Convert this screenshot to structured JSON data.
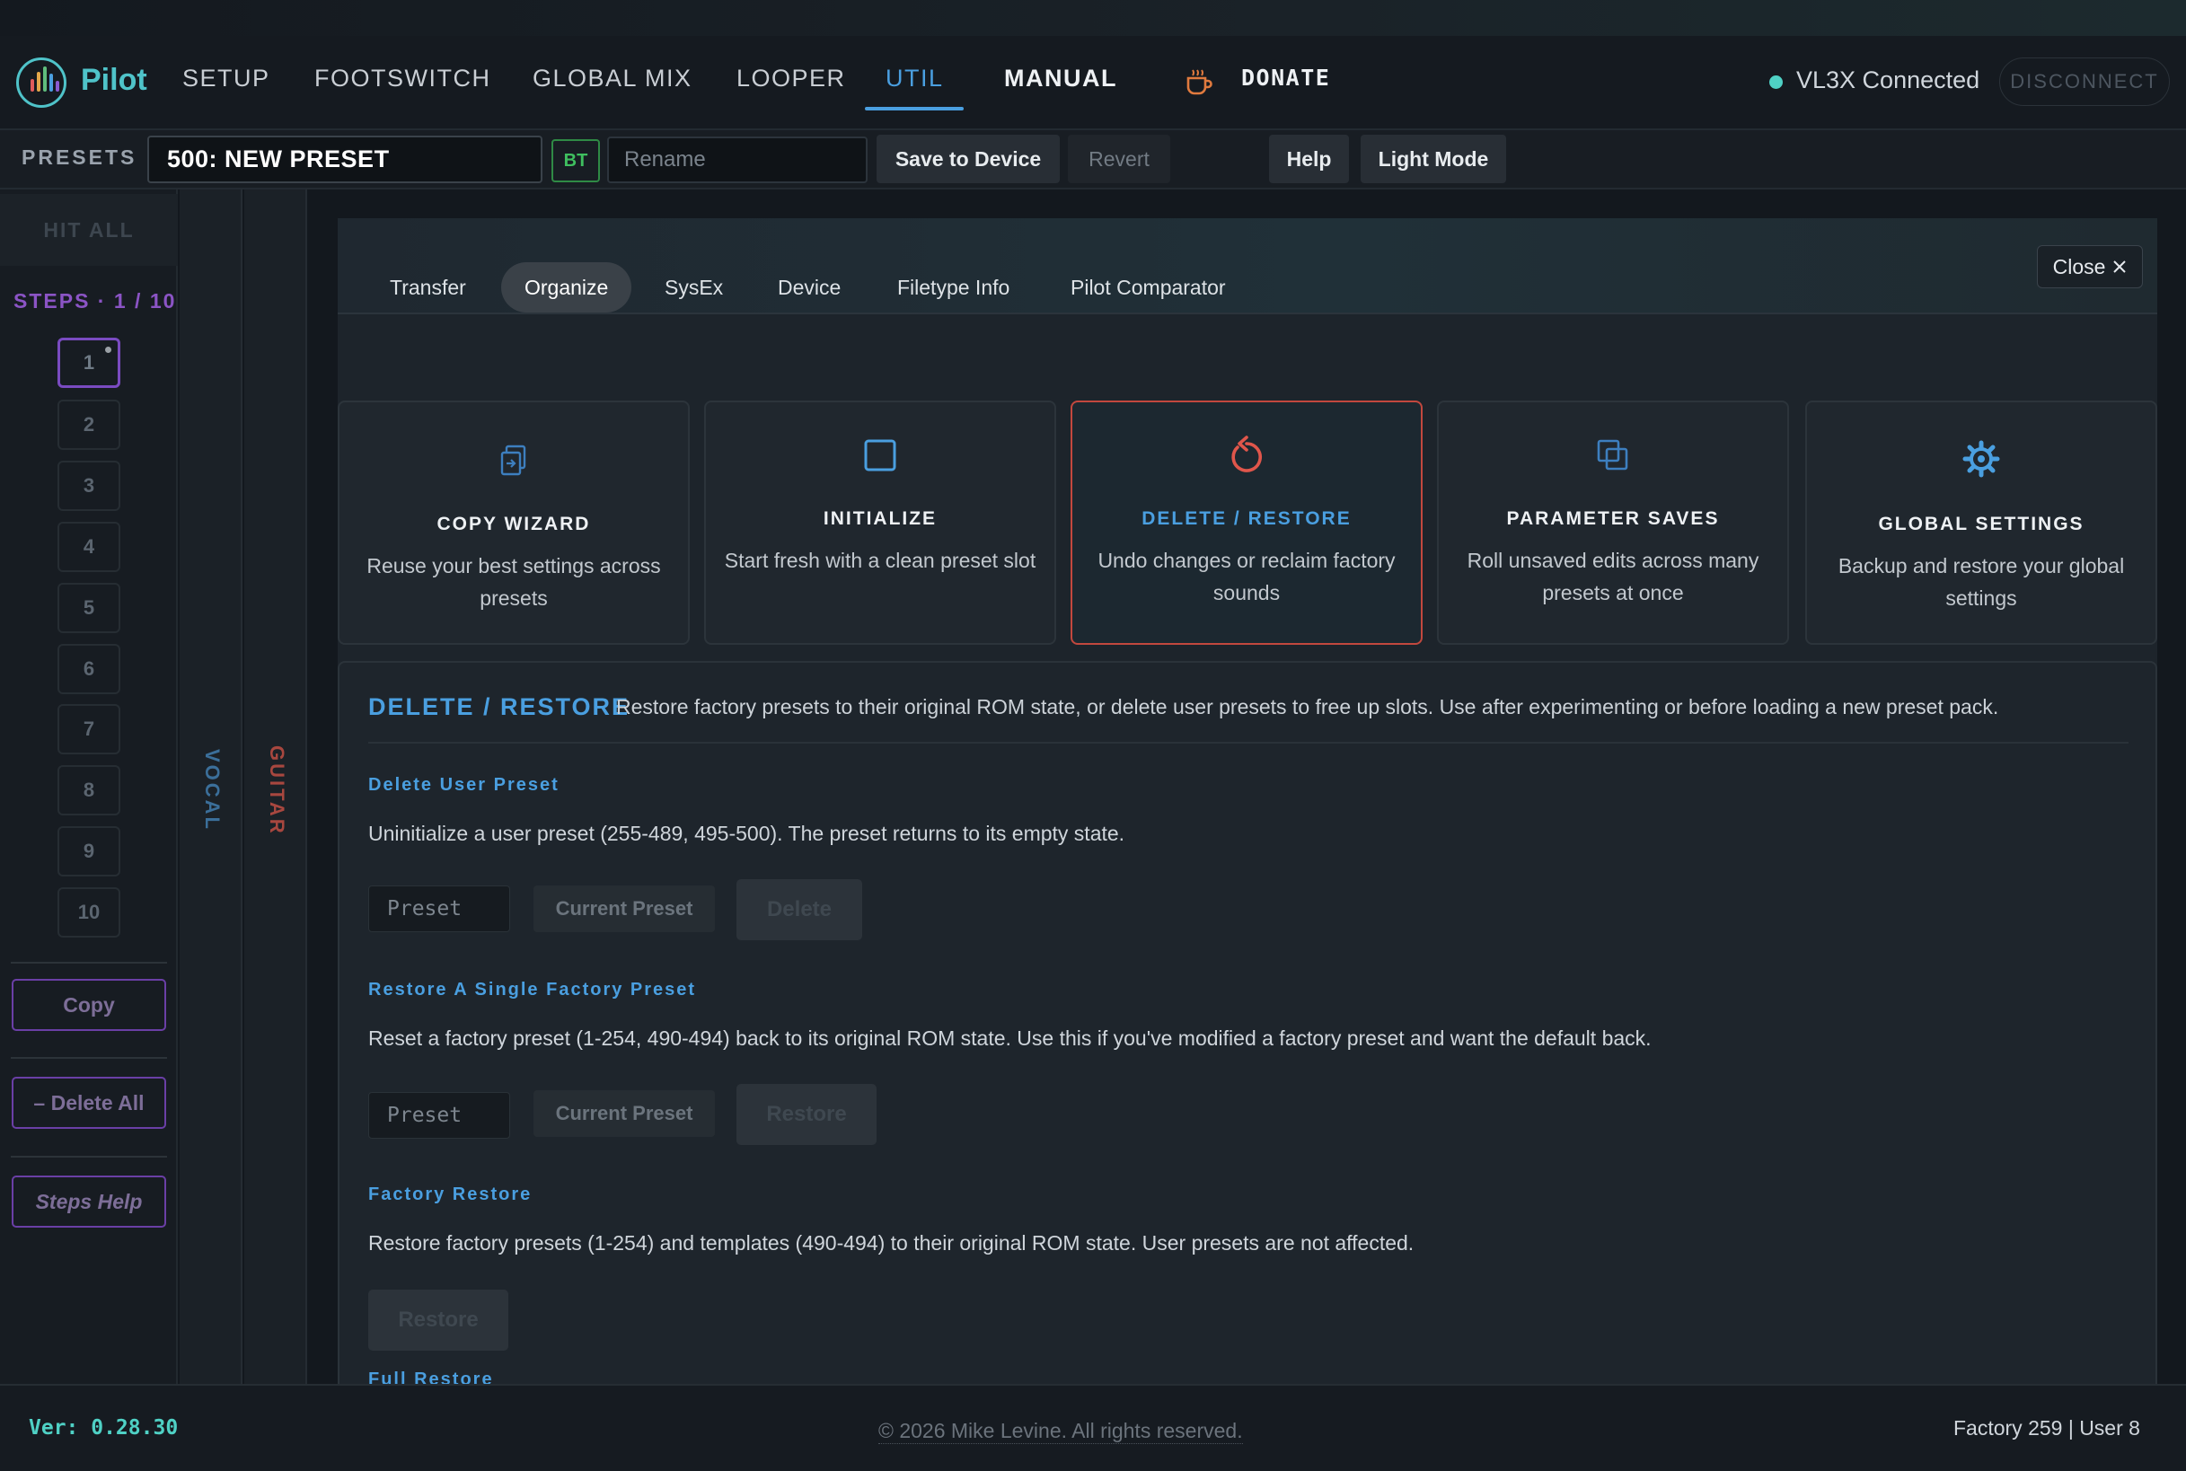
{
  "nav": {
    "brand": "Pilot",
    "items": [
      "SETUP",
      "FOOTSWITCH",
      "GLOBAL MIX",
      "LOOPER",
      "UTIL"
    ],
    "manual": "MANUAL",
    "donate": "DONATE",
    "status": "VL3X Connected",
    "disconnect": "DISCONNECT",
    "colors": {
      "accent": "#4a9fe0",
      "brand": "#4fc3c9",
      "connected": "#4fd1c5"
    }
  },
  "presets": {
    "label": "PRESETS",
    "current": "500: NEW PRESET",
    "bt": "BT",
    "rename_placeholder": "Rename",
    "save": "Save to Device",
    "revert": "Revert",
    "help": "Help",
    "light_mode": "Light Mode"
  },
  "sidebar": {
    "hit_all": "HIT ALL",
    "steps_label": "STEPS · 1 / 10",
    "steps": [
      "1",
      "2",
      "3",
      "4",
      "5",
      "6",
      "7",
      "8",
      "9",
      "10"
    ],
    "copy": "Copy",
    "delete_all": "– Delete All",
    "steps_help": "Steps Help"
  },
  "strips": {
    "vocal": "VOCAL",
    "guitar": "GUITAR"
  },
  "tabs": [
    "Transfer",
    "Organize",
    "SysEx",
    "Device",
    "Filetype Info",
    "Pilot Comparator"
  ],
  "close": "Close",
  "cards": [
    {
      "title": "COPY WIZARD",
      "desc": "Reuse your best settings across presets",
      "icon": "copy-icon"
    },
    {
      "title": "INITIALIZE",
      "desc": "Start fresh with a clean preset slot",
      "icon": "square-icon"
    },
    {
      "title": "DELETE / RESTORE",
      "desc": "Undo changes or reclaim factory sounds",
      "icon": "restore-icon"
    },
    {
      "title": "PARAMETER SAVES",
      "desc": "Roll unsaved edits across many presets at once",
      "icon": "layers-icon"
    },
    {
      "title": "GLOBAL SETTINGS",
      "desc": "Backup and restore your global settings",
      "icon": "gear-icon"
    }
  ],
  "detail": {
    "title": "DELETE / RESTORE",
    "subtitle": "Restore factory presets to their original ROM state, or delete user presets to free up slots. Use after experimenting or before loading a new preset pack.",
    "sections": [
      {
        "title": "Delete User Preset",
        "text": "Uninitialize a user preset (255-489, 495-500). The preset returns to its empty state.",
        "placeholder": "Preset",
        "current": "Current Preset",
        "action": "Delete"
      },
      {
        "title": "Restore A Single Factory Preset",
        "text": "Reset a factory preset (1-254, 490-494) back to its original ROM state. Use this if you've modified a factory preset and want the default back.",
        "placeholder": "Preset",
        "current": "Current Preset",
        "action": "Restore"
      },
      {
        "title": "Factory Restore",
        "text": "Restore factory presets (1-254) and templates (490-494) to their original ROM state. User presets are not affected.",
        "action": "Restore"
      },
      {
        "title": "Full Restore"
      }
    ]
  },
  "footer": {
    "version": "Ver: 0.28.30",
    "copyright": "© 2026 Mike Levine. All rights reserved.",
    "counts": "Factory 259 | User 8"
  }
}
